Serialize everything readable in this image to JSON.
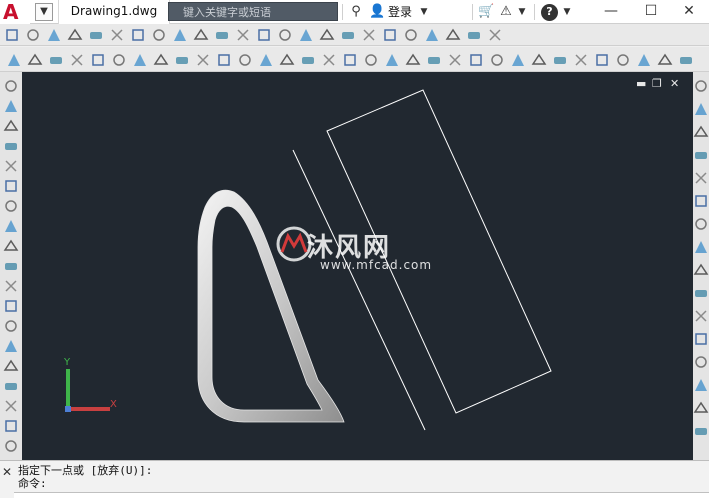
{
  "app": {
    "logo_letter": "A",
    "document_title": "Drawing1.dwg",
    "search_placeholder": "键入关键字或短语",
    "login_label": "登录",
    "help_label": "?",
    "window_controls": {
      "minimize": "—",
      "maximize": "☐",
      "close": "✕"
    }
  },
  "viewport": {
    "controls": {
      "minimize": "▬",
      "restore": "❐",
      "close": "✕"
    },
    "watermark": {
      "main": "沐风网",
      "sub": "www.mfcad.com"
    },
    "ucs": {
      "x_label": "X",
      "y_label": "Y"
    }
  },
  "command": {
    "history": [
      "指定下一点或 [放弃(U)]:",
      "命令:"
    ]
  },
  "colors": {
    "canvas_background": "#212830",
    "ucs_x": "#c84040",
    "ucs_y": "#3fb54a",
    "ucs_z": "#4d7fd6",
    "drawing_lines": "#ffffff",
    "logo": "#c8102e"
  },
  "icons": {
    "top_toolbar_1": [
      "hook-icon",
      "box-icon",
      "wedge-icon",
      "cone-icon",
      "sphere-icon",
      "cylinder-icon",
      "torus-icon",
      "pyramid-icon",
      "planar-surface-icon",
      "extrude-icon",
      "presspull-icon",
      "sweep-icon",
      "revolve-icon",
      "loft-icon",
      "union-icon",
      "subtract-icon",
      "intersect-icon",
      "slice-icon",
      "interfere-icon",
      "section-icon",
      "3d-align-icon",
      "3d-mirror-icon",
      "3d-rotate-icon",
      "3d-array-icon"
    ],
    "top_toolbar_2": [
      "orbit-icon",
      "walk-icon",
      "fly-icon",
      "visual-style-icon",
      "camera-icon",
      "named-views-icon",
      "views-icon"
    ],
    "left_sidebar": [
      "line-icon",
      "construction-line-icon",
      "polyline-icon",
      "polygon-icon",
      "rectangle-icon",
      "arc-icon",
      "circle-icon",
      "revcloud-icon",
      "spline-icon",
      "ellipse-icon",
      "ellipse-arc-icon",
      "insert-block-icon",
      "make-block-icon",
      "point-icon",
      "hatch-icon",
      "gradient-icon",
      "region-icon",
      "table-icon",
      "text-icon"
    ],
    "right_sidebar": [
      "erase-icon",
      "copy-icon",
      "mirror-icon",
      "offset-icon",
      "array-icon",
      "move-icon",
      "rotate-icon",
      "scale-icon",
      "stretch-icon",
      "trim-icon",
      "extend-icon",
      "break-icon",
      "join-icon",
      "chamfer-icon",
      "fillet-icon",
      "explode-icon"
    ]
  }
}
